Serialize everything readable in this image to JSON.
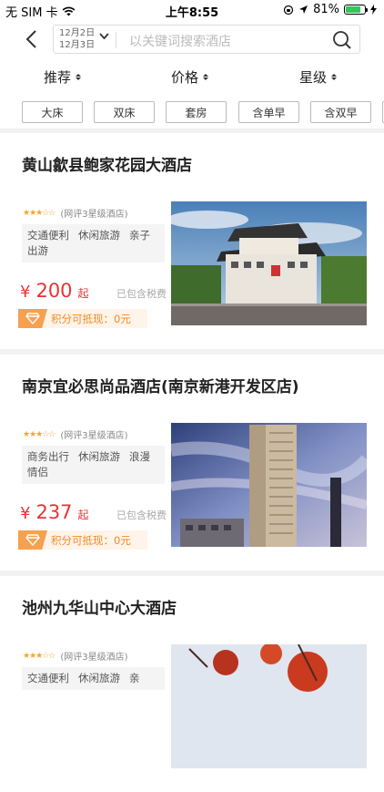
{
  "status_bar": {
    "carrier": "无 SIM 卡",
    "time": "上午8:55",
    "battery": "81%",
    "battery_level": 0.81
  },
  "header": {
    "checkin": "12月2日",
    "checkout": "12月3日",
    "search_placeholder": "以关键词搜索酒店"
  },
  "sort": {
    "recommend": "推荐",
    "price": "价格",
    "stars": "星级"
  },
  "filters": [
    "大床",
    "双床",
    "套房",
    "含单早",
    "含双早"
  ],
  "hotels": [
    {
      "name": "黄山歙县鲍家花园大酒店",
      "rating_text": "(网评3星级酒店)",
      "tags": [
        "交通便利",
        "休闲旅游",
        "亲子出游"
      ],
      "currency": "¥",
      "price": "200",
      "price_suffix": "起",
      "tax_note": "已包含税费",
      "points_text": "积分可抵现：0元",
      "stars": 3.5
    },
    {
      "name": "南京宜必思尚品酒店(南京新港开发区店)",
      "rating_text": "(网评3星级酒店)",
      "tags": [
        "商务出行",
        "休闲旅游",
        "浪漫情侣"
      ],
      "currency": "¥",
      "price": "237",
      "price_suffix": "起",
      "tax_note": "已包含税费",
      "points_text": "积分可抵现：0元",
      "stars": 3.5
    },
    {
      "name": "池州九华山中心大酒店",
      "rating_text": "(网评3星级酒店)",
      "tags": [
        "交通便利",
        "休闲旅游",
        "亲"
      ],
      "stars": 3.5
    }
  ]
}
